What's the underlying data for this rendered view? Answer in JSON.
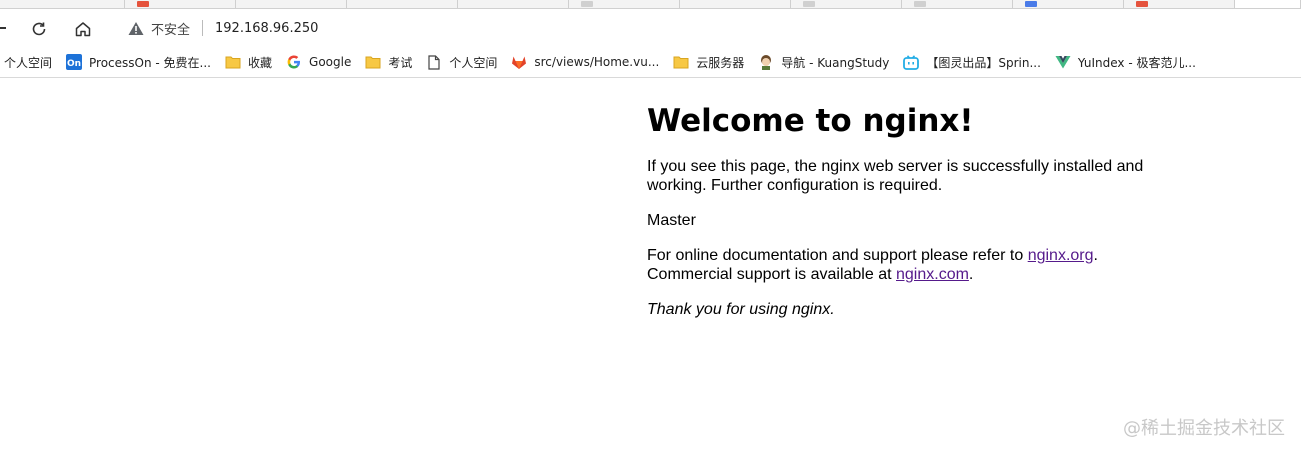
{
  "browser": {
    "security_label": "不安全",
    "url": "192.168.96.250",
    "bookmarks": [
      {
        "label": "个人空间",
        "icon": "none-icon"
      },
      {
        "label": "ProcessOn - 免费在...",
        "icon": "processon-icon"
      },
      {
        "label": "收藏",
        "icon": "folder-icon"
      },
      {
        "label": "Google",
        "icon": "google-icon"
      },
      {
        "label": "考试",
        "icon": "folder-icon"
      },
      {
        "label": "个人空间",
        "icon": "page-icon"
      },
      {
        "label": "src/views/Home.vu...",
        "icon": "gitlab-icon"
      },
      {
        "label": "云服务器",
        "icon": "folder-icon"
      },
      {
        "label": "导航 - KuangStudy",
        "icon": "avatar-icon"
      },
      {
        "label": "【图灵出品】Sprin...",
        "icon": "bilibili-icon"
      },
      {
        "label": "YuIndex - 极客范儿...",
        "icon": "vue-icon"
      }
    ]
  },
  "page": {
    "title": "Welcome to nginx!",
    "p1": "If you see this page, the nginx web server is successfully installed and working. Further configuration is required.",
    "p2": "Master",
    "p3_pre": "For online documentation and support please refer to ",
    "link1": "nginx.org",
    "p3_mid": ".",
    "p3_line2_pre": "Commercial support is available at ",
    "link2": "nginx.com",
    "p3_end": ".",
    "thanks": "Thank you for using nginx."
  },
  "watermark": "@稀土掘金技术社区",
  "colors": {
    "link_visited": "#551a8b",
    "warning": "#5f6368"
  }
}
